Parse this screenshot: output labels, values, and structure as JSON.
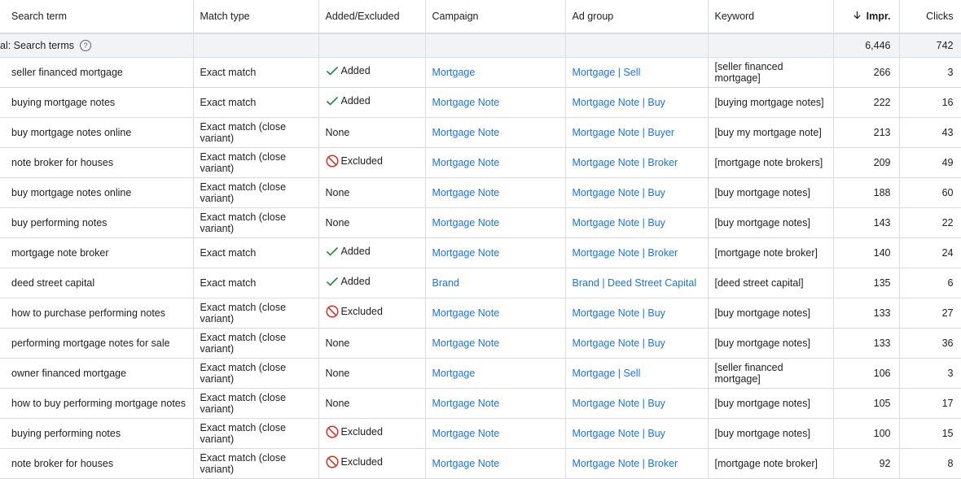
{
  "table": {
    "headers": {
      "search_term": "Search term",
      "match_type": "Match type",
      "added_excluded": "Added/Excluded",
      "campaign": "Campaign",
      "ad_group": "Ad group",
      "keyword": "Keyword",
      "impr": "Impr.",
      "clicks": "Clicks"
    },
    "total": {
      "label": "al: Search terms",
      "impr": "6,446",
      "clicks": "742"
    },
    "rows": [
      {
        "term": "seller financed mortgage",
        "match": "Exact match",
        "status": "Added",
        "campaign": "Mortgage",
        "adgroup": "Mortgage | Sell",
        "keyword": "[seller financed mortgage]",
        "impr": "266",
        "clicks": "3"
      },
      {
        "term": "buying mortgage notes",
        "match": "Exact match",
        "status": "Added",
        "campaign": "Mortgage Note",
        "adgroup": "Mortgage Note | Buy",
        "keyword": "[buying mortgage notes]",
        "impr": "222",
        "clicks": "16"
      },
      {
        "term": "buy mortgage notes online",
        "match": "Exact match (close variant)",
        "status": "None",
        "campaign": "Mortgage Note",
        "adgroup": "Mortgage Note | Buyer",
        "keyword": "[buy my mortgage note]",
        "impr": "213",
        "clicks": "43"
      },
      {
        "term": "note broker for houses",
        "match": "Exact match (close variant)",
        "status": "Excluded",
        "campaign": "Mortgage Note",
        "adgroup": "Mortgage Note | Broker",
        "keyword": "[mortgage note brokers]",
        "impr": "209",
        "clicks": "49"
      },
      {
        "term": "buy mortgage notes online",
        "match": "Exact match (close variant)",
        "status": "None",
        "campaign": "Mortgage Note",
        "adgroup": "Mortgage Note | Buy",
        "keyword": "[buy mortgage notes]",
        "impr": "188",
        "clicks": "60"
      },
      {
        "term": "buy performing notes",
        "match": "Exact match (close variant)",
        "status": "None",
        "campaign": "Mortgage Note",
        "adgroup": "Mortgage Note | Buy",
        "keyword": "[buy mortgage notes]",
        "impr": "143",
        "clicks": "22"
      },
      {
        "term": "mortgage note broker",
        "match": "Exact match",
        "status": "Added",
        "campaign": "Mortgage Note",
        "adgroup": "Mortgage Note | Broker",
        "keyword": "[mortgage note broker]",
        "impr": "140",
        "clicks": "24"
      },
      {
        "term": "deed street capital",
        "match": "Exact match",
        "status": "Added",
        "campaign": "Brand",
        "adgroup": "Brand | Deed Street Capital",
        "keyword": "[deed street capital]",
        "impr": "135",
        "clicks": "6"
      },
      {
        "term": "how to purchase performing notes",
        "match": "Exact match (close variant)",
        "status": "Excluded",
        "campaign": "Mortgage Note",
        "adgroup": "Mortgage Note | Buy",
        "keyword": "[buy mortgage notes]",
        "impr": "133",
        "clicks": "27"
      },
      {
        "term": "performing mortgage notes for sale",
        "match": "Exact match (close variant)",
        "status": "None",
        "campaign": "Mortgage Note",
        "adgroup": "Mortgage Note | Buy",
        "keyword": "[buy mortgage notes]",
        "impr": "133",
        "clicks": "36"
      },
      {
        "term": "owner financed mortgage",
        "match": "Exact match (close variant)",
        "status": "None",
        "campaign": "Mortgage",
        "adgroup": "Mortgage | Sell",
        "keyword": "[seller financed mortgage]",
        "impr": "106",
        "clicks": "3"
      },
      {
        "term": "how to buy performing mortgage notes",
        "match": "Exact match (close variant)",
        "status": "None",
        "campaign": "Mortgage Note",
        "adgroup": "Mortgage Note | Buy",
        "keyword": "[buy mortgage notes]",
        "impr": "105",
        "clicks": "17"
      },
      {
        "term": "buying performing notes",
        "match": "Exact match (close variant)",
        "status": "Excluded",
        "campaign": "Mortgage Note",
        "adgroup": "Mortgage Note | Buy",
        "keyword": "[buy mortgage notes]",
        "impr": "100",
        "clicks": "15"
      },
      {
        "term": "note broker for houses",
        "match": "Exact match (close variant)",
        "status": "Excluded",
        "campaign": "Mortgage Note",
        "adgroup": "Mortgage Note | Broker",
        "keyword": "[mortgage note broker]",
        "impr": "92",
        "clicks": "8"
      }
    ]
  },
  "icons": {
    "added": "check-icon",
    "excluded": "ban-icon",
    "help": "help-icon",
    "sort": "arrow-down-icon"
  },
  "colors": {
    "link": "#1a73e8",
    "added": "#1e8e3e",
    "excluded": "#d93025",
    "total_row_bg": "#f1f3f4",
    "border": "#dadce0"
  }
}
